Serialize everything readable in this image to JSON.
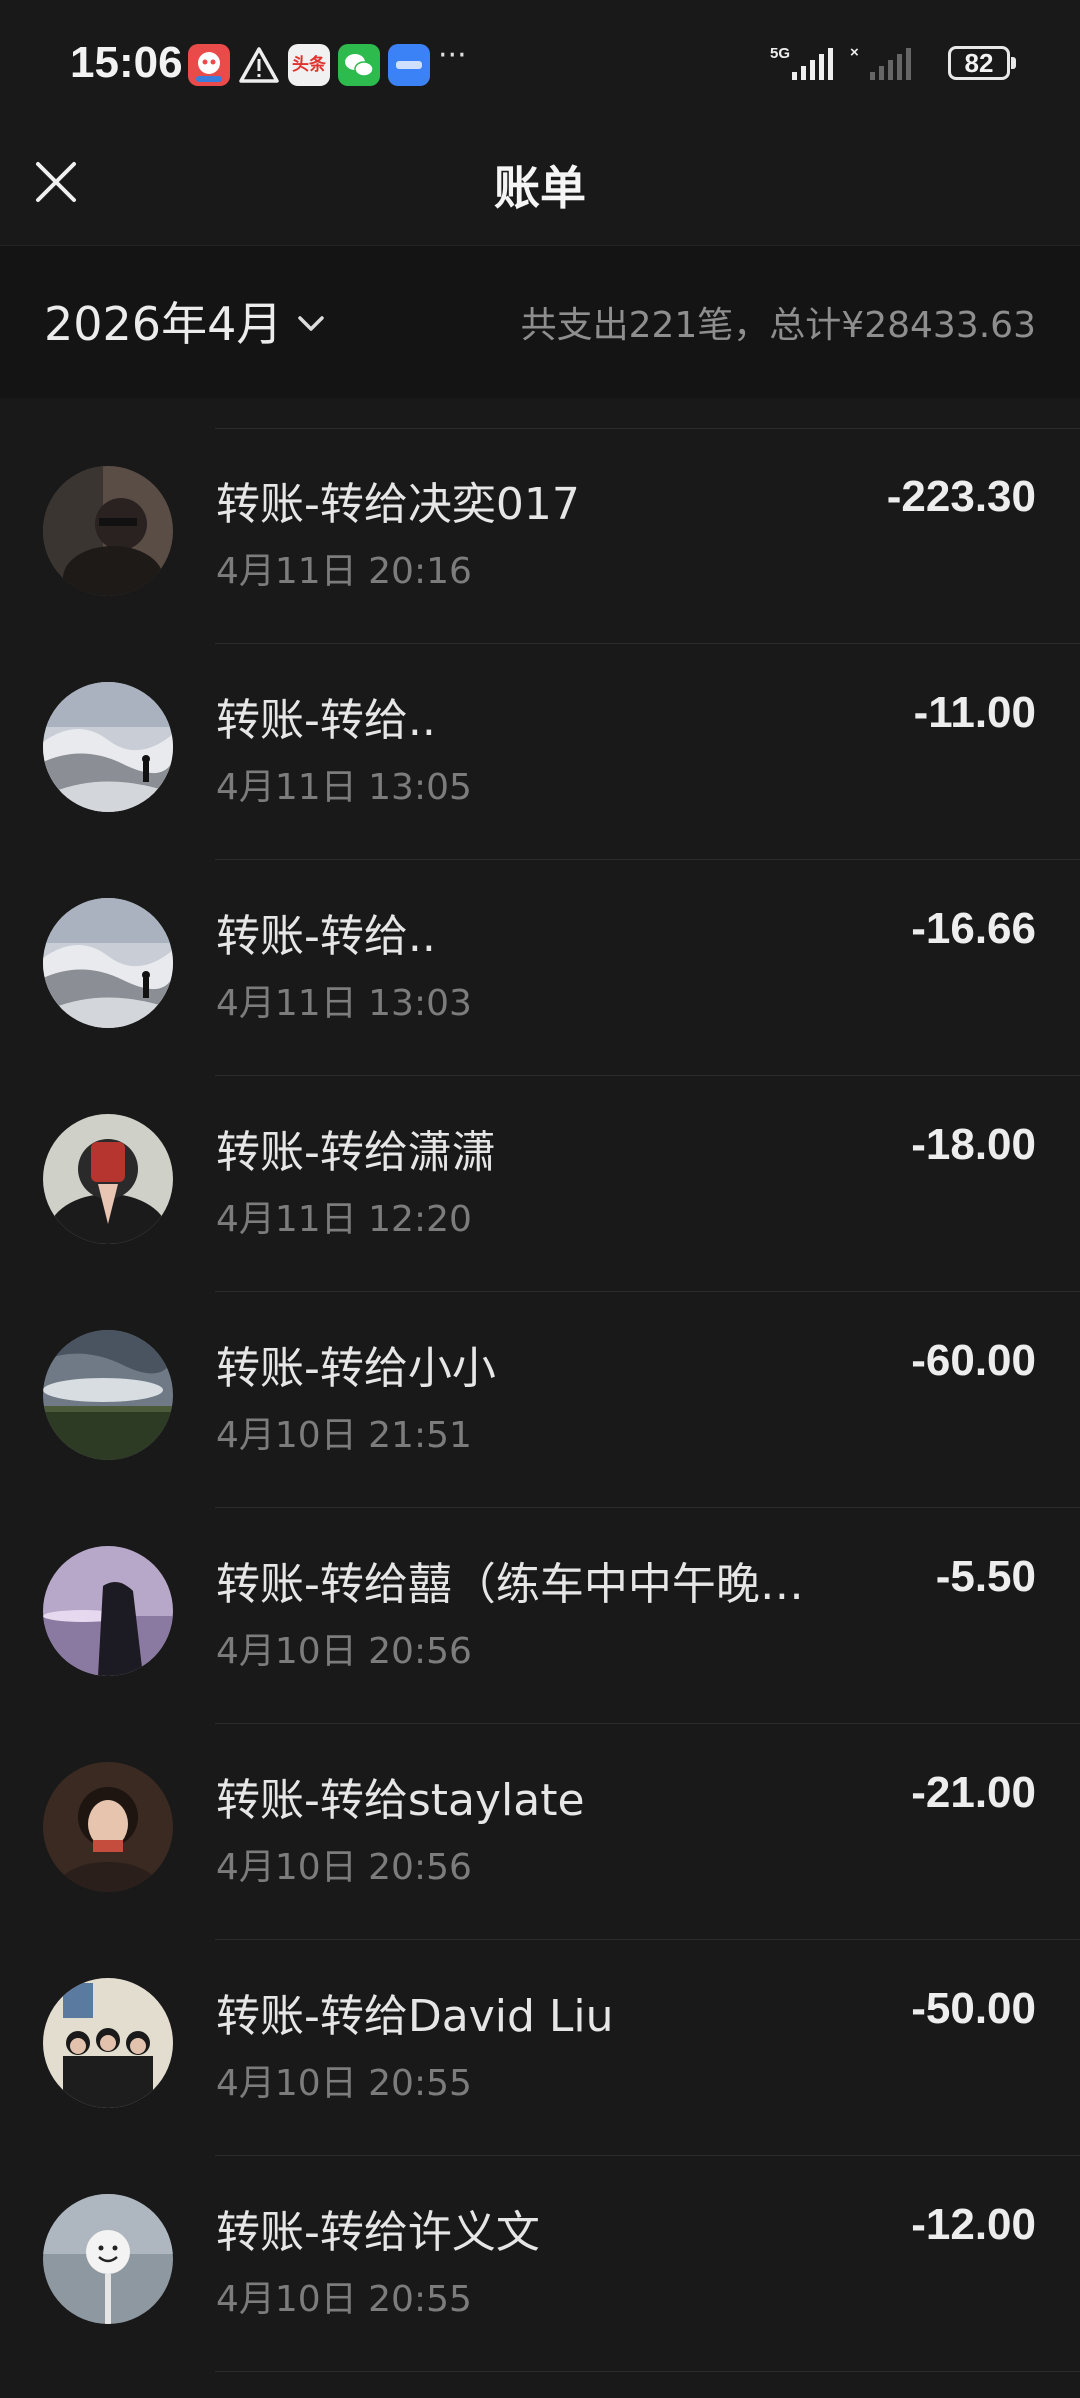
{
  "status_bar": {
    "time": "15:06",
    "network": "5G",
    "battery": "82",
    "notification_icons": [
      "alert-app-icon",
      "warning-icon",
      "toutiao-icon",
      "wechat-icon",
      "work-app-icon"
    ],
    "toutiao_label": "头条",
    "more": "···"
  },
  "header": {
    "title": "账单"
  },
  "filter": {
    "month": "2026年4月",
    "summary": "共支出221笔，总计¥28433.63"
  },
  "transactions": [
    {
      "title": "转账-转给决奕017",
      "date": "4月11日 20:16",
      "amount": "-223.30"
    },
    {
      "title": "转账-转给..",
      "date": "4月11日 13:05",
      "amount": "-11.00"
    },
    {
      "title": "转账-转给..",
      "date": "4月11日 13:03",
      "amount": "-16.66"
    },
    {
      "title": "转账-转给潇潇",
      "date": "4月11日 12:20",
      "amount": "-18.00"
    },
    {
      "title": "转账-转给小小",
      "date": "4月10日 21:51",
      "amount": "-60.00"
    },
    {
      "title": "转账-转给囍（练车中中午晚…",
      "date": "4月10日 20:56",
      "amount": "-5.50"
    },
    {
      "title": "转账-转给staylate",
      "date": "4月10日 20:56",
      "amount": "-21.00"
    },
    {
      "title": "转账-转给David Liu",
      "date": "4月10日 20:55",
      "amount": "-50.00"
    },
    {
      "title": "转账-转给许义文",
      "date": "4月10日 20:55",
      "amount": "-12.00"
    }
  ],
  "colors": {
    "background": "#191919",
    "filter_bar": "#141414",
    "primary_text": "#e6e6e6",
    "secondary_text": "#7c7c7c"
  }
}
